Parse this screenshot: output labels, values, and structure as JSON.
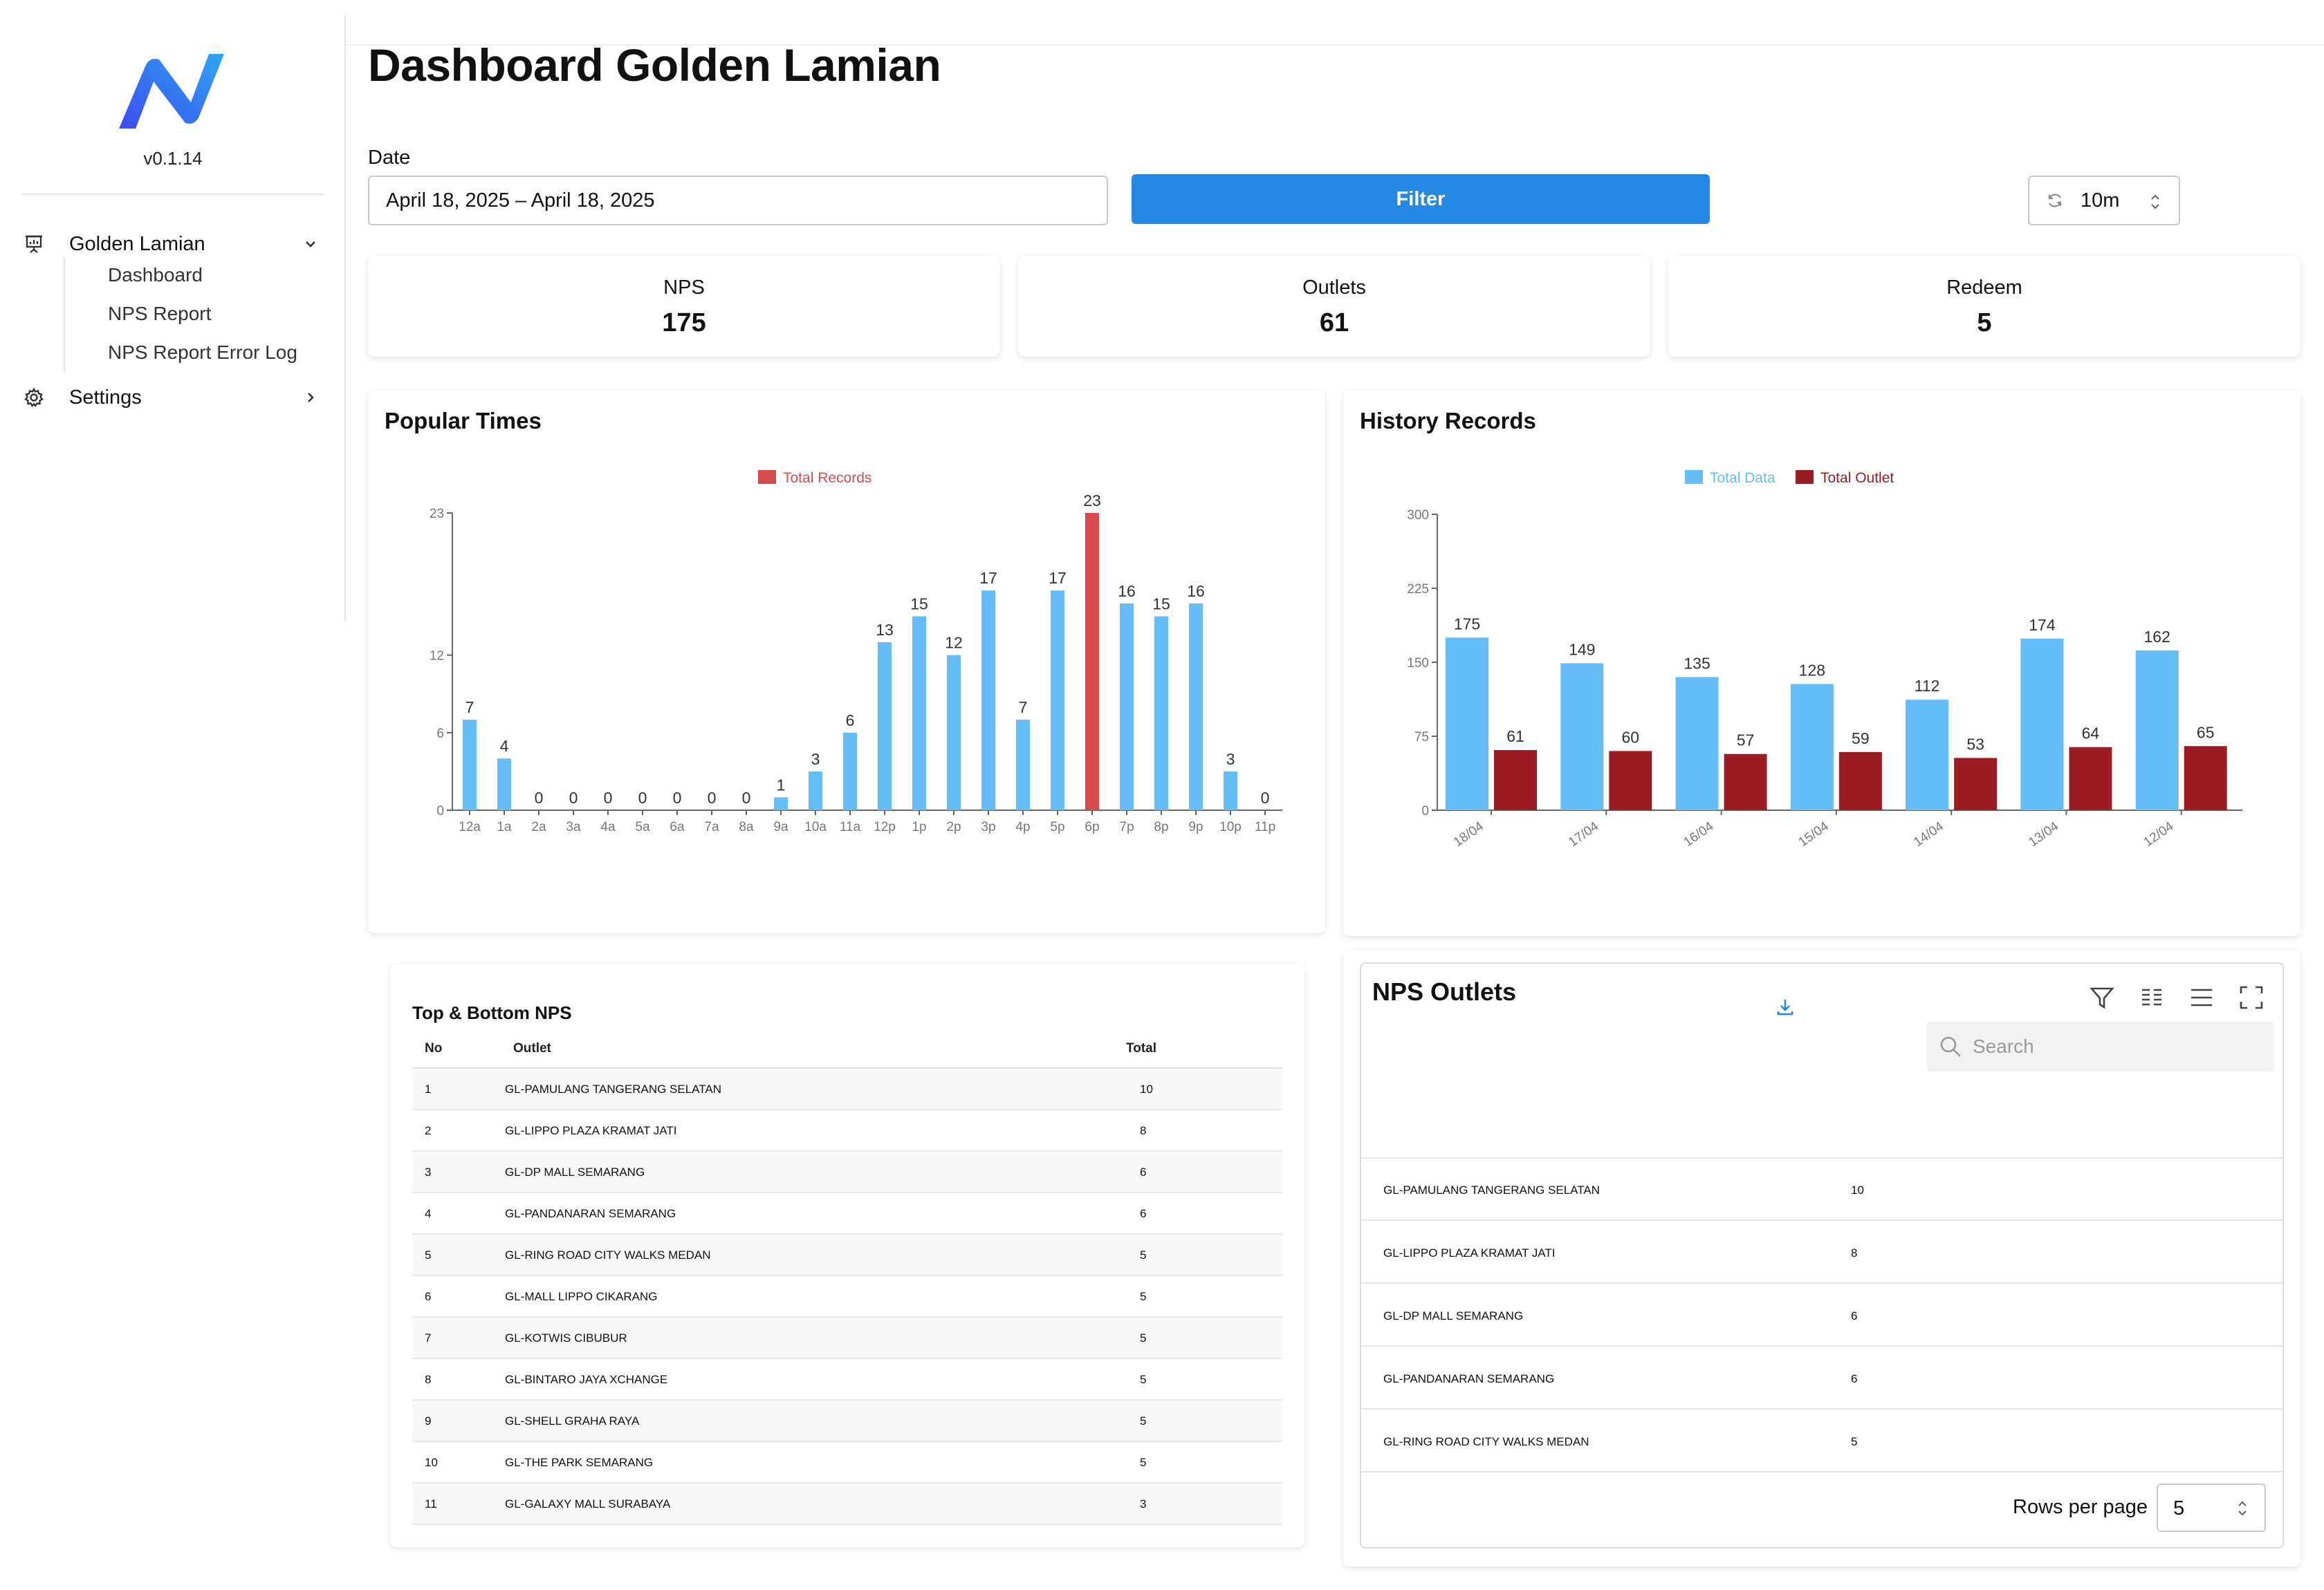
{
  "app": {
    "version": "v0.1.14"
  },
  "sidebar": {
    "group": {
      "label": "Golden Lamian",
      "icon": "presentation-chart-icon",
      "expanded": true
    },
    "items": [
      {
        "label": "Dashboard"
      },
      {
        "label": "NPS Report"
      },
      {
        "label": "NPS Report Error Log"
      }
    ],
    "settings": {
      "label": "Settings",
      "icon": "gear-icon"
    }
  },
  "header": {
    "title": "Dashboard Golden Lamian"
  },
  "filters": {
    "date_label": "Date",
    "date_value": "April 18, 2025 – April 18, 2025",
    "filter_label": "Filter",
    "refresh_value": "10m"
  },
  "stats": [
    {
      "label": "NPS",
      "value": "175"
    },
    {
      "label": "Outlets",
      "value": "61"
    },
    {
      "label": "Redeem",
      "value": "5"
    }
  ],
  "popular_times": {
    "title": "Popular Times"
  },
  "history_records": {
    "title": "History Records"
  },
  "chart_data": [
    {
      "type": "bar",
      "title": "Popular Times",
      "categories": [
        "12a",
        "1a",
        "2a",
        "3a",
        "4a",
        "5a",
        "6a",
        "7a",
        "8a",
        "9a",
        "10a",
        "11a",
        "12p",
        "1p",
        "2p",
        "3p",
        "4p",
        "5p",
        "6p",
        "7p",
        "8p",
        "9p",
        "10p",
        "11p"
      ],
      "series": [
        {
          "name": "Total Records",
          "values": [
            7,
            4,
            0,
            0,
            0,
            0,
            0,
            0,
            0,
            1,
            3,
            6,
            13,
            15,
            12,
            17,
            7,
            17,
            23,
            16,
            15,
            16,
            3,
            0
          ]
        }
      ],
      "highlight_index": 18,
      "yticks": [
        0,
        6,
        12,
        23
      ],
      "ylim": [
        0,
        23
      ],
      "colors": {
        "bar": "#64bdf6",
        "highlight": "#d64b4b"
      },
      "legend_position": "top-center"
    },
    {
      "type": "bar",
      "title": "History Records",
      "categories": [
        "18/04",
        "17/04",
        "16/04",
        "15/04",
        "14/04",
        "13/04",
        "12/04"
      ],
      "series": [
        {
          "name": "Total Data",
          "values": [
            175,
            149,
            135,
            128,
            112,
            174,
            162
          ]
        },
        {
          "name": "Total Outlet",
          "values": [
            61,
            60,
            57,
            59,
            53,
            64,
            65
          ]
        }
      ],
      "yticks": [
        0,
        75,
        150,
        225,
        300
      ],
      "ylim": [
        0,
        300
      ],
      "colors": {
        "series": [
          "#64bdf6",
          "#9b1c22"
        ]
      },
      "legend_position": "top-center"
    }
  ],
  "top_bottom": {
    "title": "Top & Bottom NPS",
    "columns": [
      "No",
      "Outlet",
      "Total"
    ],
    "rows": [
      [
        "1",
        "GL-PAMULANG TANGERANG SELATAN",
        "10"
      ],
      [
        "2",
        "GL-LIPPO PLAZA KRAMAT JATI",
        "8"
      ],
      [
        "3",
        "GL-DP MALL SEMARANG",
        "6"
      ],
      [
        "4",
        "GL-PANDANARAN SEMARANG",
        "6"
      ],
      [
        "5",
        "GL-RING ROAD CITY WALKS MEDAN",
        "5"
      ],
      [
        "6",
        "GL-MALL LIPPO CIKARANG",
        "5"
      ],
      [
        "7",
        "GL-KOTWIS CIBUBUR",
        "5"
      ],
      [
        "8",
        "GL-BINTARO JAYA XCHANGE",
        "5"
      ],
      [
        "9",
        "GL-SHELL GRAHA RAYA",
        "5"
      ],
      [
        "10",
        "GL-THE PARK SEMARANG",
        "5"
      ],
      [
        "11",
        "GL-GALAXY MALL SURABAYA",
        "3"
      ]
    ]
  },
  "nps_outlets": {
    "title": "NPS Outlets",
    "search_placeholder": "Search",
    "rows": [
      [
        "GL-PAMULANG TANGERANG SELATAN",
        "10"
      ],
      [
        "GL-LIPPO PLAZA KRAMAT JATI",
        "8"
      ],
      [
        "GL-DP MALL SEMARANG",
        "6"
      ],
      [
        "GL-PANDANARAN SEMARANG",
        "6"
      ],
      [
        "GL-RING ROAD CITY WALKS MEDAN",
        "5"
      ]
    ],
    "rows_per_page_label": "Rows per page",
    "rows_per_page_value": "5"
  }
}
